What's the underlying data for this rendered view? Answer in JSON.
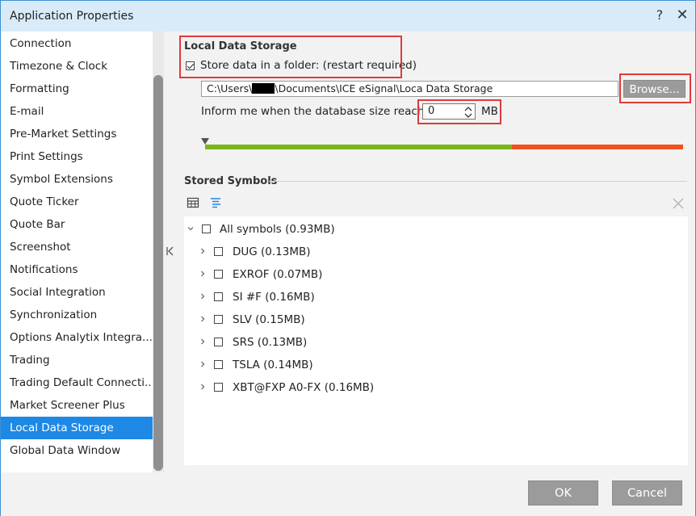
{
  "window": {
    "title": "Application Properties",
    "help_label": "?",
    "close_label": "✕"
  },
  "sidebar": {
    "items": [
      {
        "label": "Connection"
      },
      {
        "label": "Timezone & Clock"
      },
      {
        "label": "Formatting"
      },
      {
        "label": "E-mail"
      },
      {
        "label": "Pre-Market Settings"
      },
      {
        "label": "Print Settings"
      },
      {
        "label": "Symbol Extensions"
      },
      {
        "label": "Quote Ticker"
      },
      {
        "label": "Quote Bar"
      },
      {
        "label": "Screenshot"
      },
      {
        "label": "Notifications"
      },
      {
        "label": "Social Integration"
      },
      {
        "label": "Synchronization"
      },
      {
        "label": "Options Analytix Integra..."
      },
      {
        "label": "Trading"
      },
      {
        "label": "Trading Default Connecti..."
      },
      {
        "label": "Market Screener Plus"
      },
      {
        "label": "Local Data Storage"
      },
      {
        "label": "Global Data Window"
      }
    ],
    "active_index": 17
  },
  "local_storage": {
    "title": "Local Data Storage",
    "store_checkbox_label": "Store data in a folder:  (restart required)",
    "store_checked": true,
    "path_prefix": "C:\\Users\\",
    "path_suffix": "\\Documents\\ICE eSignal\\Loca Data Storage",
    "browse_label": "Browse...",
    "inform_label": "Inform me when the database size reaches:",
    "size_value": "0",
    "size_unit": "MB",
    "usage_fraction": 0.0
  },
  "stored_symbols": {
    "title": "Stored Symbols",
    "root_label": "All symbols (0.93MB)",
    "symbols": [
      {
        "label": "DUG (0.13MB)"
      },
      {
        "label": "EXROF (0.07MB)"
      },
      {
        "label": "SI #F (0.16MB)"
      },
      {
        "label": "SLV (0.15MB)"
      },
      {
        "label": "SRS (0.13MB)"
      },
      {
        "label": "TSLA (0.14MB)"
      },
      {
        "label": "XBT@FXP A0-FX (0.16MB)"
      }
    ]
  },
  "footer": {
    "ok_label": "OK",
    "cancel_label": "Cancel"
  },
  "colors": {
    "accent": "#1e88e5",
    "highlight": "#e03a3a",
    "bar_ok": "#7cb518",
    "bar_warn": "#f0501e"
  }
}
